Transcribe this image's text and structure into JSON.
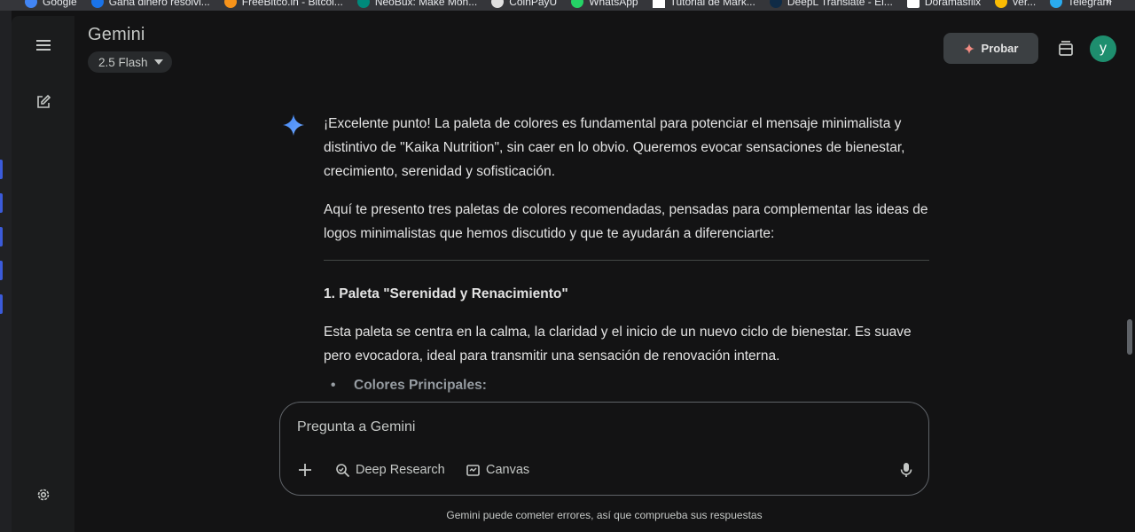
{
  "bookmarks": {
    "items": [
      {
        "label": "Google",
        "color": "#4285f4"
      },
      {
        "label": "Gana dinero resolvi...",
        "color": "#1a73e8"
      },
      {
        "label": "FreeBitco.in - Bitcoi...",
        "color": "#f7931a"
      },
      {
        "label": "NeoBux: Make Mon...",
        "color": "#00897b"
      },
      {
        "label": "CoinPayU",
        "color": "#e0e0e0"
      },
      {
        "label": "WhatsApp",
        "color": "#25d366"
      },
      {
        "label": "Tutorial de Mark...",
        "color": "#ffffff"
      },
      {
        "label": "DeepL Translate - El...",
        "color": "#0f2b46"
      },
      {
        "label": "Doramasflix",
        "color": "#ffffff"
      },
      {
        "label": "ver...",
        "color": "#fbbc04"
      },
      {
        "label": "Telegram",
        "color": "#2aabee"
      }
    ],
    "overflow_icon": "double-chevron-right-icon"
  },
  "header": {
    "title": "Gemini",
    "model": "2.5 Flash",
    "upgrade_label": "Probar",
    "avatar_letter": "y",
    "avatar_color": "#1e8e6e"
  },
  "response": {
    "para1": "¡Excelente punto! La paleta de colores es fundamental para potenciar el mensaje minimalista y distintivo de \"Kaika Nutrition\", sin caer en lo obvio. Queremos evocar sensaciones de bienestar, crecimiento, serenidad y sofisticación.",
    "para2": "Aquí te presento tres paletas de colores recomendadas, pensadas para complementar las ideas de logos minimalistas que hemos discutido y que te ayudarán a diferenciarte:",
    "heading1": "1. Paleta \"Serenidad y Renacimiento\"",
    "para3": "Esta paleta se centra en la calma, la claridad y el inicio de un nuevo ciclo de bienestar. Es suave pero evocadora, ideal para transmitir una sensación de renovación interna.",
    "bullet1": "Colores Principales:"
  },
  "composer": {
    "placeholder": "Pregunta a Gemini",
    "deep_research_label": "Deep Research",
    "canvas_label": "Canvas"
  },
  "footer": {
    "disclaimer": "Gemini puede cometer errores, así que comprueba sus respuestas"
  },
  "colors": {
    "background": "#131314",
    "sidebar": "#1b1c1d",
    "accent_blue": "#4285f4",
    "upgrade_spark": "#f28b82"
  }
}
